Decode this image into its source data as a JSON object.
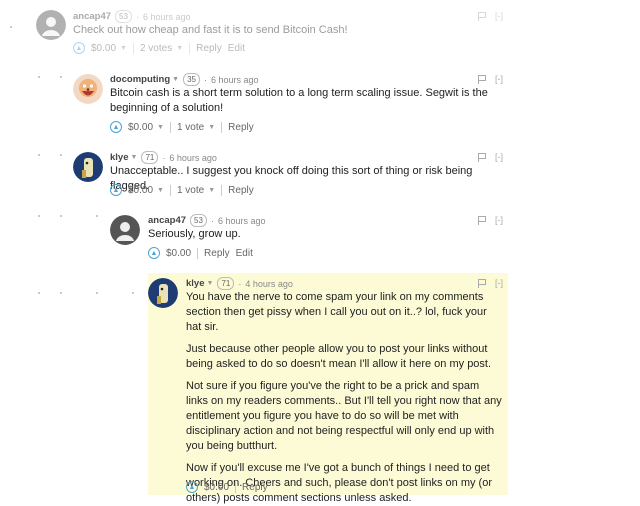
{
  "comments": [
    {
      "author": "ancap47",
      "rep": "53",
      "time": "6 hours ago",
      "body": [
        "Check out how cheap and fast it is to send Bitcoin Cash!"
      ],
      "amount": "$0.00",
      "votes": "2 votes",
      "actions": [
        "Reply",
        "Edit"
      ],
      "collapse": "[-]"
    },
    {
      "author": "docomputing",
      "rep": "35",
      "time": "6 hours ago",
      "body": [
        "Bitcoin cash is a short term solution to a long term scaling issue. Segwit is the beginning of a solution!"
      ],
      "amount": "$0.00",
      "votes": "1 vote",
      "actions": [
        "Reply"
      ],
      "collapse": "[-]"
    },
    {
      "author": "klye",
      "rep": "71",
      "time": "6 hours ago",
      "body": [
        "Unacceptable.. I suggest you knock off doing this sort of thing or risk being flagged."
      ],
      "amount": "$0.00",
      "votes": "1 vote",
      "actions": [
        "Reply"
      ],
      "collapse": "[-]"
    },
    {
      "author": "ancap47",
      "rep": "53",
      "time": "6 hours ago",
      "body": [
        "Seriously, grow up."
      ],
      "amount": "$0.00",
      "actions": [
        "Reply",
        "Edit"
      ],
      "collapse": "[-]"
    },
    {
      "author": "klye",
      "rep": "71",
      "time": "4 hours ago",
      "body": [
        "You have the nerve to come spam your link on my comments section then get pissy when I call you out on it..? lol, fuck your hat sir.",
        "Just because other people allow you to post your links without being asked to do so doesn't mean I'll allow it here on my post.",
        "Not sure if you figure you've the right to be a prick and spam links on my readers comments.. But I'll tell you right now that any entitlement you figure you have to do so will be met with disciplinary action and not being respectful will only end up with you being butthurt.",
        "Now if you'll excuse me I've got a bunch of things I need to get working on. Cheers and such, please don't post links on my (or others) posts comment sections unless asked."
      ],
      "amount": "$0.00",
      "actions": [
        "Reply"
      ],
      "collapse": "[-]"
    }
  ],
  "colors": {
    "accent": "#4aa3d8",
    "highlight": "#fdfbd6"
  },
  "icons": {
    "upvote": "chevron-up-icon",
    "flag": "flag-icon",
    "dropdown": "caret-down-icon"
  }
}
